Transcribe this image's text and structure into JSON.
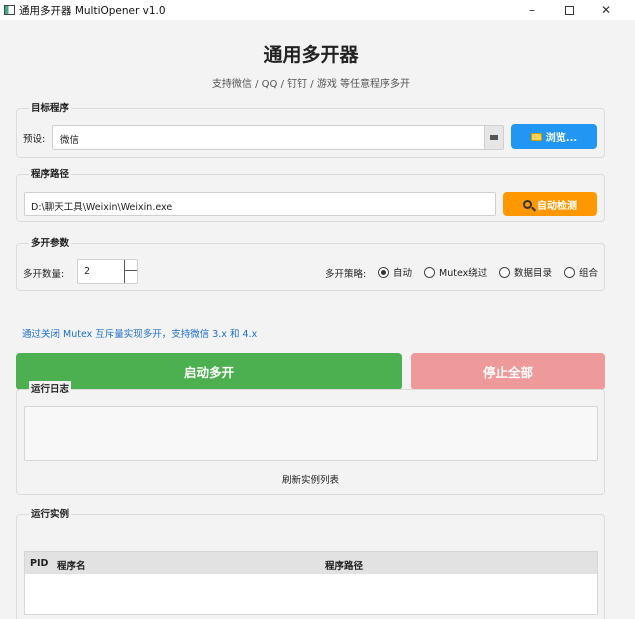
{
  "window": {
    "title": "通用多开器 MultiOpener v1.0",
    "minimize": "–",
    "close": "✕"
  },
  "header": {
    "title": "通用多开器",
    "subtitle": "支持微信 / QQ / 钉钉 / 游戏 等任意程序多开"
  },
  "target": {
    "group_title": "目标程序",
    "preset_label": "预设:",
    "preset_value": "微信",
    "browse_label": "浏览..."
  },
  "path": {
    "group_title": "程序路径",
    "value": "D:\\聊天工具\\Weixin\\Weixin.exe",
    "detect_label": "自动检测"
  },
  "params": {
    "group_title": "多开参数",
    "count_label": "多开数量:",
    "count_value": "2",
    "strategy_label": "多开策略:",
    "options": [
      {
        "label": "自动",
        "selected": true
      },
      {
        "label": "Mutex绕过",
        "selected": false
      },
      {
        "label": "数据目录",
        "selected": false
      },
      {
        "label": "组合",
        "selected": false
      }
    ]
  },
  "hint": "通过关闭 Mutex 互斥量实现多开，支持微信 3.x 和 4.x",
  "actions": {
    "start_label": "启动多开",
    "stop_label": "停止全部"
  },
  "log": {
    "group_title": "运行日志",
    "refresh_label": "刷新实例列表"
  },
  "instances": {
    "group_title": "运行实例",
    "columns": [
      "PID",
      "程序名",
      "程序路径"
    ]
  },
  "colors": {
    "browse": "#2196f3",
    "detect": "#ff9800",
    "start": "#4caf50",
    "stop": "#ef9a9a",
    "hint": "#1e6fc8"
  }
}
